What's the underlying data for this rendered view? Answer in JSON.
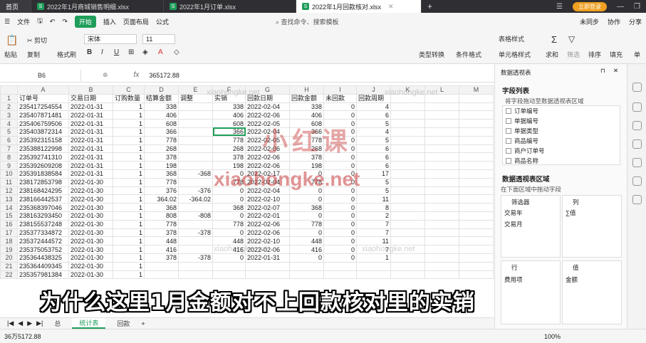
{
  "file_tabs": [
    {
      "label": "首页",
      "kind": "home"
    },
    {
      "label": "2022年1月商城销售明细.xlsx"
    },
    {
      "label": "2022年1月订单.xlsx"
    },
    {
      "label": "2022年1月回款核对.xlsx",
      "active": true
    }
  ],
  "window": {
    "login": "立即登录"
  },
  "menu": {
    "file": "文件",
    "items": [
      "开始",
      "插入",
      "页面布局",
      "公式"
    ],
    "search": "查找命令、搜索模板",
    "sync": "未同步",
    "collab": "协作",
    "share": "分享"
  },
  "ribbon": {
    "cut": "剪切",
    "paste": "粘贴",
    "copy": "复制",
    "format_painter": "格式刷",
    "font_name": "宋体",
    "font_size": "11",
    "table_style": "表格样式",
    "type_convert": "类型转换",
    "cond_format": "条件格式",
    "cell_style": "单元格样式",
    "sum": "求和",
    "filter": "筛选",
    "sort": "排序",
    "fill": "填充",
    "single": "单"
  },
  "formula_bar": {
    "cell_ref": "B6",
    "fx": "fx",
    "value": "365172.88"
  },
  "sheet": {
    "col_letters": [
      "A",
      "B",
      "C",
      "D",
      "E",
      "F",
      "G",
      "H",
      "I",
      "J",
      "K",
      "L",
      "M"
    ],
    "header": [
      "订单号",
      "交易日期",
      "订购数量",
      "结算金额",
      "调整",
      "实销",
      "回款日期",
      "回款金额",
      "未回款",
      "回款周期",
      "",
      "",
      ""
    ],
    "rows": [
      [
        "235417254554",
        "2022-01-31",
        "1",
        "338",
        "",
        "338",
        "2022-02-04",
        "338",
        "0",
        "4",
        "",
        "",
        ""
      ],
      [
        "235407871481",
        "2022-01-31",
        "1",
        "406",
        "",
        "406",
        "2022-02-06",
        "406",
        "0",
        "6",
        "",
        "",
        ""
      ],
      [
        "235406759506",
        "2022-01-31",
        "1",
        "608",
        "",
        "608",
        "2022-02-05",
        "608",
        "0",
        "5",
        "",
        "",
        ""
      ],
      [
        "235403872314",
        "2022-01-31",
        "1",
        "366",
        "",
        "366",
        "2022-02-04",
        "366",
        "0",
        "4",
        "",
        "",
        ""
      ],
      [
        "235392315158",
        "2022-01-31",
        "1",
        "778",
        "",
        "778",
        "2022-02-05",
        "778",
        "0",
        "5",
        "",
        "",
        ""
      ],
      [
        "235388122998",
        "2022-01-31",
        "1",
        "268",
        "",
        "268",
        "2022-02-06",
        "268",
        "0",
        "6",
        "",
        "",
        ""
      ],
      [
        "235392741310",
        "2022-01-31",
        "1",
        "378",
        "",
        "378",
        "2022-02-06",
        "378",
        "0",
        "6",
        "",
        "",
        ""
      ],
      [
        "235392609208",
        "2022-01-31",
        "1",
        "198",
        "",
        "198",
        "2022-02-06",
        "198",
        "0",
        "6",
        "",
        "",
        ""
      ],
      [
        "235391838584",
        "2022-01-31",
        "1",
        "368",
        "-368",
        "0",
        "2022-02-17",
        "0",
        "0",
        "17",
        "",
        "",
        ""
      ],
      [
        "238172853798",
        "2022-01-30",
        "1",
        "778",
        "",
        "778",
        "2022-02-04",
        "778",
        "0",
        "5",
        "",
        "",
        ""
      ],
      [
        "238168424295",
        "2022-01-30",
        "1",
        "376",
        "-376",
        "0",
        "2022-02-04",
        "0",
        "0",
        "5",
        "",
        "",
        ""
      ],
      [
        "238166442537",
        "2022-01-30",
        "1",
        "364.02",
        "-364.02",
        "0",
        "2022-02-10",
        "0",
        "0",
        "11",
        "",
        "",
        ""
      ],
      [
        "235368397046",
        "2022-01-30",
        "1",
        "368",
        "",
        "368",
        "2022-02-07",
        "368",
        "0",
        "8",
        "",
        "",
        ""
      ],
      [
        "238163293450",
        "2022-01-30",
        "1",
        "808",
        "-808",
        "0",
        "2022-02-01",
        "0",
        "0",
        "2",
        "",
        "",
        ""
      ],
      [
        "238155537248",
        "2022-01-30",
        "1",
        "778",
        "",
        "778",
        "2022-02-06",
        "778",
        "0",
        "7",
        "",
        "",
        ""
      ],
      [
        "235377334872",
        "2022-01-30",
        "1",
        "378",
        "-378",
        "0",
        "2022-02-06",
        "0",
        "0",
        "7",
        "",
        "",
        ""
      ],
      [
        "235372444572",
        "2022-01-30",
        "1",
        "448",
        "",
        "448",
        "2022-02-10",
        "448",
        "0",
        "11",
        "",
        "",
        ""
      ],
      [
        "235375053752",
        "2022-01-30",
        "1",
        "416",
        "",
        "416",
        "2022-02-06",
        "416",
        "0",
        "7",
        "",
        "",
        ""
      ],
      [
        "235364438325",
        "2022-01-30",
        "1",
        "378",
        "-378",
        "0",
        "2022-01-31",
        "0",
        "0",
        "1",
        "",
        "",
        ""
      ],
      [
        "235364409345",
        "2022-01-30",
        "1",
        "",
        "",
        "",
        "",
        "",
        "",
        "",
        "",
        "",
        ""
      ],
      [
        "235357981384",
        "2022-01-30",
        "1",
        "",
        "",
        "",
        "",
        "",
        "",
        "",
        "",
        "",
        ""
      ]
    ]
  },
  "sheet_tabs": [
    "总",
    "统计表",
    "回款"
  ],
  "active_sheet": "统计表",
  "status": {
    "sum": "36万5172.88",
    "zoom": "100%"
  },
  "pivot": {
    "title": "数据透视表",
    "field_list": "字段列表",
    "field_hint": "将字段拖动至数据透视表区域",
    "fields": [
      "订单编号",
      "单据编号",
      "单据类型",
      "商品编号",
      "商户订单号",
      "商品名称"
    ],
    "area_title": "数据透视表区域",
    "area_hint": "在下面区域中拖动字段",
    "filter_label": "筛选器",
    "col_label": "列",
    "filter_items": [
      "交易年",
      "交易月"
    ],
    "col_items": [
      "∑值"
    ],
    "row_label": "行",
    "value_label": "值",
    "row_items": [
      "费用项"
    ],
    "value_items": [
      "金额"
    ]
  },
  "overlays": {
    "subtitle": "为什么这里1月金额对不上回款核对里的实销",
    "watermark_text": "xiaohongke.net",
    "watermark_logo": "小红课"
  }
}
